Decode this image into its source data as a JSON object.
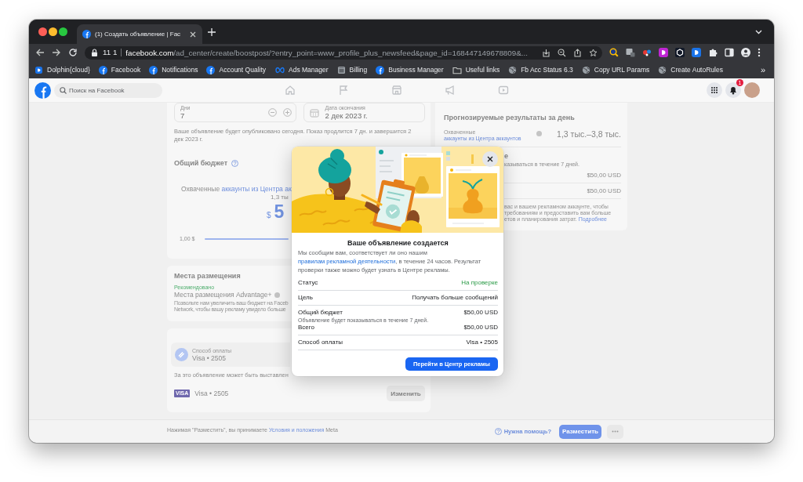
{
  "browser": {
    "tabs": [
      {
        "title": "(1) Создать объявление | Fac",
        "selected": true
      }
    ],
    "address_bar": {
      "site_info": "11 1",
      "host": "facebook.com",
      "path": "/ad_center/create/boostpost/?entry_point=www_profile_plus_newsfeed&page_id=168447149678809&..."
    },
    "bookmarks": [
      {
        "kind": "dolphin",
        "label": "Dolphin{cloud}"
      },
      {
        "kind": "facebook",
        "label": "Facebook"
      },
      {
        "kind": "facebook",
        "label": "Notifications"
      },
      {
        "kind": "facebook",
        "label": "Account Quality"
      },
      {
        "kind": "meta",
        "label": "Ads Manager"
      },
      {
        "kind": "billing",
        "label": "Billing"
      },
      {
        "kind": "facebook",
        "label": "Business Manager"
      },
      {
        "kind": "folder",
        "label": "Useful links"
      },
      {
        "kind": "globe",
        "label": "Fb Acc Status 6.3"
      },
      {
        "kind": "globe",
        "label": "Copy URL Params"
      },
      {
        "kind": "globe",
        "label": "Create AutoRules"
      }
    ],
    "bookmarks_overflow": "»"
  },
  "header": {
    "search": {
      "placeholder": "Поиск на Facebook"
    },
    "notification_count": "1"
  },
  "schedule": {
    "days": {
      "label": "Дни",
      "value": "7"
    },
    "end_date": {
      "label": "Дата окончания",
      "value": "2 дек 2023 г."
    },
    "note": "Ваше объявление будет опубликовано сегодня. Показ продлится 7 дн. и завершится 2 дек 2023 г."
  },
  "budget": {
    "title": "Общий бюджет",
    "reach_label": "Охваченные",
    "reach_link": "аккаунты из Центра ак",
    "reach_value": "1,3 ты",
    "currency": "$",
    "amount": "5",
    "slider_min": "1,00 $"
  },
  "placements": {
    "title": "Места размещения",
    "tag": "Рекомендовано",
    "option": "Места размещения Advantage+",
    "description_lines": [
      "Позвольте нам увеличить ваш бюджет на Faceb",
      "Network, чтобы вашу рекламу увидело больше"
    ]
  },
  "payment": {
    "method_label": "Способ оплаты",
    "method_value": "Visa • 2505",
    "notice": "За это объявление может быть выставлен",
    "card_brand": "VISA",
    "card": "Visa • 2505",
    "change_button": "Изменить"
  },
  "forecast": {
    "title": "Прогнозируемые результаты за день",
    "reach_label": "Охваченные",
    "reach_link": "аккаунты из Центра аккаунтов",
    "reach_value": "1,3 тыс.–3,8 тыс.",
    "covered_title": "е",
    "covered_note": "казываться в течение 7 дней.",
    "amounts": [
      "$50,00 USD",
      "$50,00 USD"
    ],
    "covered_paragraph_lines": [
      "вас и вашем рекламном аккаунте, чтобы",
      "требованиям и предоставить вам больше",
      "етов и планирования затрат."
    ],
    "more_link": "Подробнее"
  },
  "footer": {
    "terms_before": "Нажимая \"Разместить\", вы принимаете",
    "terms_link": "Условия и положения",
    "terms_after": "Meta",
    "help_link": "Нужна помощь?",
    "submit_button": "Разместить"
  },
  "dialog": {
    "title": "Ваше объявление создается",
    "message_before": "Мы сообщим вам, соответствует ли оно нашим",
    "message_link": "правилам рекламной деятельности",
    "message_after": ", в течение 24 часов. Результат проверки также можно будет узнать в Центре рекламы.",
    "sections": [
      {
        "rows": [
          {
            "kind": "status",
            "label": "Статус",
            "value": "На проверке"
          }
        ]
      },
      {
        "rows": [
          {
            "kind": "plain",
            "label": "Цель",
            "value": "Получать больше сообщений"
          }
        ]
      },
      {
        "rows": [
          {
            "kind": "plain",
            "label": "Общий бюджет",
            "value": "$50,00 USD",
            "note": "Объявление будет показываться в течение 7 дней."
          },
          {
            "kind": "plain",
            "label": "Всего",
            "value": "$50,00 USD"
          }
        ]
      },
      {
        "rows": [
          {
            "kind": "plain",
            "label": "Способ оплаты",
            "value": "Visa • 2505"
          }
        ]
      }
    ],
    "button": "Перейти в Центр рекламы"
  }
}
